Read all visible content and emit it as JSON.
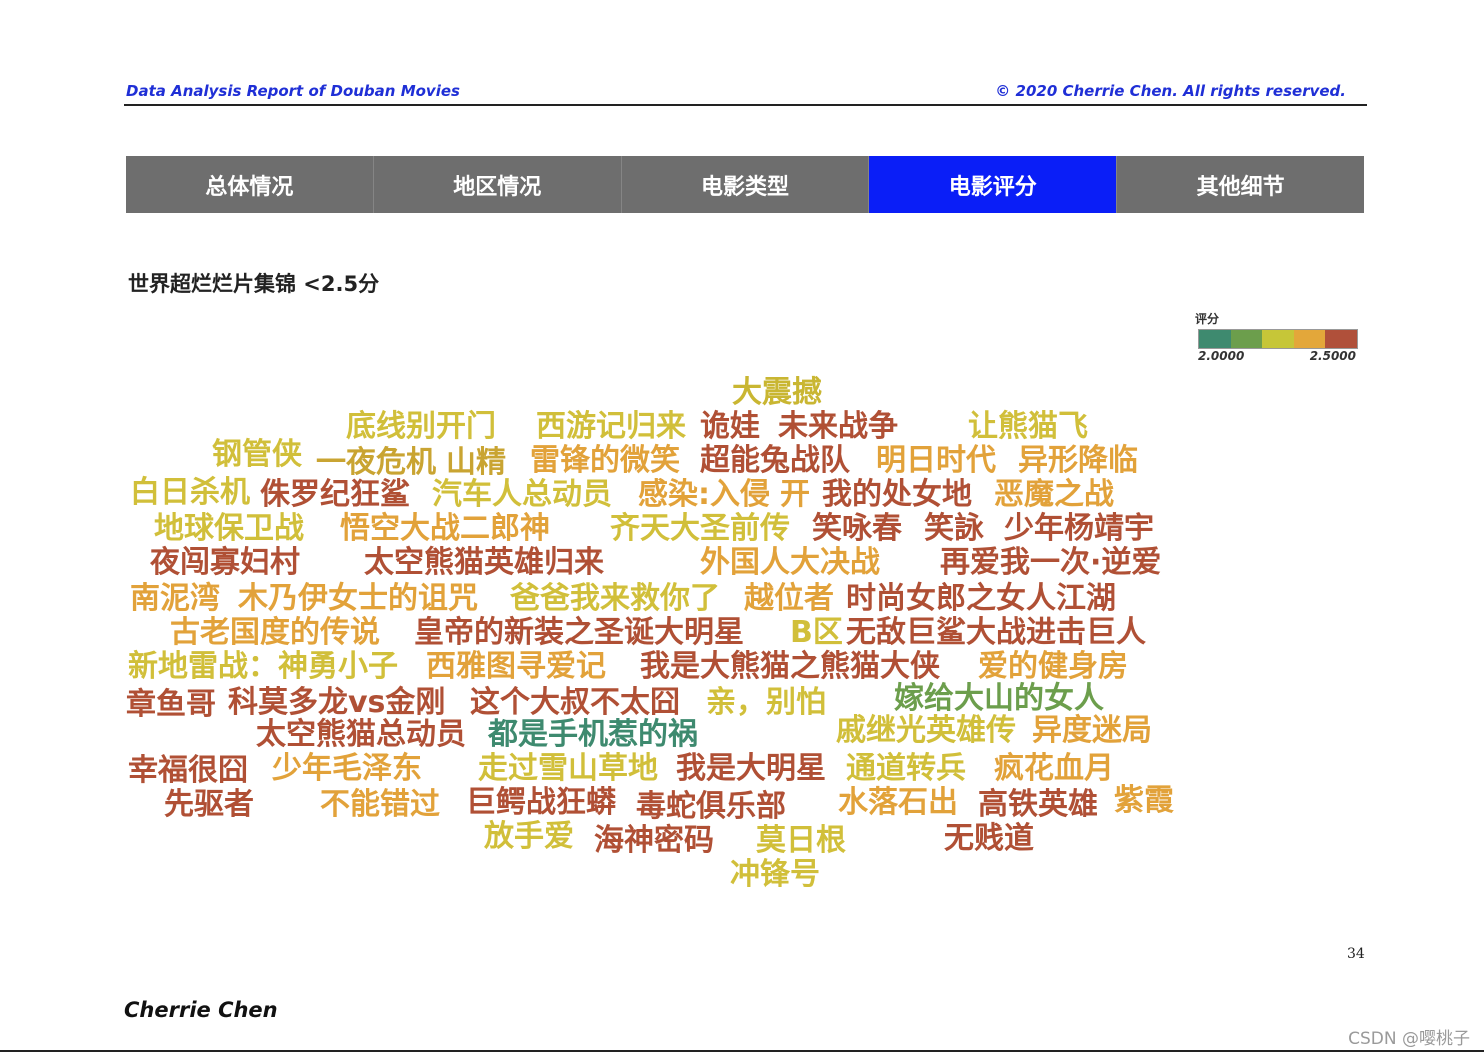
{
  "header": {
    "left": "Data Analysis Report of Douban Movies",
    "right": "© 2020 Cherrie Chen. All rights reserved."
  },
  "nav": {
    "tabs": [
      {
        "label": "总体情况",
        "active": false
      },
      {
        "label": "地区情况",
        "active": false
      },
      {
        "label": "电影类型",
        "active": false
      },
      {
        "label": "电影评分",
        "active": true
      },
      {
        "label": "其他细节",
        "active": false
      }
    ]
  },
  "section_title": "世界超烂烂片集锦 <2.5分",
  "legend": {
    "title": "评分",
    "min": "2.0000",
    "max": "2.5000",
    "colors": [
      "#3e8a6f",
      "#6c9e4c",
      "#c6c638",
      "#e3a73a",
      "#b0503a"
    ]
  },
  "wordcloud": [
    {
      "text": "大震撼",
      "color": "#c9b632"
    },
    {
      "text": "底线别开门",
      "color": "#d1bf3a"
    },
    {
      "text": "西游记归来",
      "color": "#d1bf3a"
    },
    {
      "text": "诡娃",
      "color": "#b05035"
    },
    {
      "text": "未来战争",
      "color": "#b05035"
    },
    {
      "text": "让熊猫飞",
      "color": "#d1bf3a"
    },
    {
      "text": "钢管侠",
      "color": "#d1bf3a"
    },
    {
      "text": "一夜危机",
      "color": "#c9a432"
    },
    {
      "text": "山精",
      "color": "#c9a432"
    },
    {
      "text": "雷锋的微笑",
      "color": "#e2a23a"
    },
    {
      "text": "超能兔战队",
      "color": "#b05035"
    },
    {
      "text": "明日时代",
      "color": "#e2a23a"
    },
    {
      "text": "异形降临",
      "color": "#e2a23a"
    },
    {
      "text": "白日杀机",
      "color": "#d1bf3a"
    },
    {
      "text": "侏罗纪狂鲨",
      "color": "#b05035"
    },
    {
      "text": "汽车人总动员",
      "color": "#d1bf3a"
    },
    {
      "text": "感染:入侵",
      "color": "#e2a23a"
    },
    {
      "text": "开",
      "color": "#e2a23a"
    },
    {
      "text": "我的处女地",
      "color": "#b05035"
    },
    {
      "text": "恶魔之战",
      "color": "#e2a23a"
    },
    {
      "text": "地球保卫战",
      "color": "#d1bf3a"
    },
    {
      "text": "悟空大战二郎神",
      "color": "#e2a23a"
    },
    {
      "text": "齐天大圣前传",
      "color": "#d1bf3a"
    },
    {
      "text": "笑咏春",
      "color": "#b05035"
    },
    {
      "text": "笑詠",
      "color": "#b05035"
    },
    {
      "text": "少年杨靖宇",
      "color": "#b05035"
    },
    {
      "text": "夜闯寡妇村",
      "color": "#b05035"
    },
    {
      "text": "太空熊猫英雄归来",
      "color": "#b05035"
    },
    {
      "text": "外国人大决战",
      "color": "#e2a23a"
    },
    {
      "text": "再爱我一次·逆爱",
      "color": "#b05035"
    },
    {
      "text": "南泥湾",
      "color": "#e2a23a"
    },
    {
      "text": "木乃伊女士的诅咒",
      "color": "#e2a23a"
    },
    {
      "text": "爸爸我来救你了",
      "color": "#d1bf3a"
    },
    {
      "text": "越位者",
      "color": "#e2a23a"
    },
    {
      "text": "时尚女郎之女人江湖",
      "color": "#b05035"
    },
    {
      "text": "古老国度的传说",
      "color": "#e2a23a"
    },
    {
      "text": "皇帝的新装之圣诞大明星",
      "color": "#b05035"
    },
    {
      "text": "B区",
      "color": "#d1bf3a"
    },
    {
      "text": "无敌巨鲨大战进击巨人",
      "color": "#b05035"
    },
    {
      "text": "新地雷战：神勇小子",
      "color": "#d1bf3a"
    },
    {
      "text": "西雅图寻爱记",
      "color": "#e2a23a"
    },
    {
      "text": "我是大熊猫之熊猫大侠",
      "color": "#b05035"
    },
    {
      "text": "爱的健身房",
      "color": "#e2a23a"
    },
    {
      "text": "章鱼哥",
      "color": "#b05035"
    },
    {
      "text": "科莫多龙vs金刚",
      "color": "#b05035"
    },
    {
      "text": "这个大叔不太囧",
      "color": "#b05035"
    },
    {
      "text": "亲，别怕",
      "color": "#d1bf3a"
    },
    {
      "text": "嫁给大山的女人",
      "color": "#6c9e4c"
    },
    {
      "text": "太空熊猫总动员",
      "color": "#b05035"
    },
    {
      "text": "都是手机惹的祸",
      "color": "#3e8a6f"
    },
    {
      "text": "戚继光英雄传",
      "color": "#d1bf3a"
    },
    {
      "text": "异度迷局",
      "color": "#e2a23a"
    },
    {
      "text": "幸福很囧",
      "color": "#b05035"
    },
    {
      "text": "少年毛泽东",
      "color": "#e2a23a"
    },
    {
      "text": "走过雪山草地",
      "color": "#d1bf3a"
    },
    {
      "text": "我是大明星",
      "color": "#b05035"
    },
    {
      "text": "通道转兵",
      "color": "#d1bf3a"
    },
    {
      "text": "疯花血月",
      "color": "#e2a23a"
    },
    {
      "text": "先驱者",
      "color": "#b05035"
    },
    {
      "text": "不能错过",
      "color": "#e2a23a"
    },
    {
      "text": "巨鳄战狂蟒",
      "color": "#b05035"
    },
    {
      "text": "毒蛇俱乐部",
      "color": "#b05035"
    },
    {
      "text": "水落石出",
      "color": "#e2a23a"
    },
    {
      "text": "高铁英雄",
      "color": "#b05035"
    },
    {
      "text": "紫霞",
      "color": "#e2a23a"
    },
    {
      "text": "放手爱",
      "color": "#d1bf3a"
    },
    {
      "text": "海神密码",
      "color": "#b05035"
    },
    {
      "text": "莫日根",
      "color": "#d1bf3a"
    },
    {
      "text": "无贱道",
      "color": "#b05035"
    },
    {
      "text": "冲锋号",
      "color": "#d1bf3a"
    }
  ],
  "page_number": "34",
  "footer_author": "Cherrie Chen",
  "watermark": "CSDN @嘤桃子"
}
